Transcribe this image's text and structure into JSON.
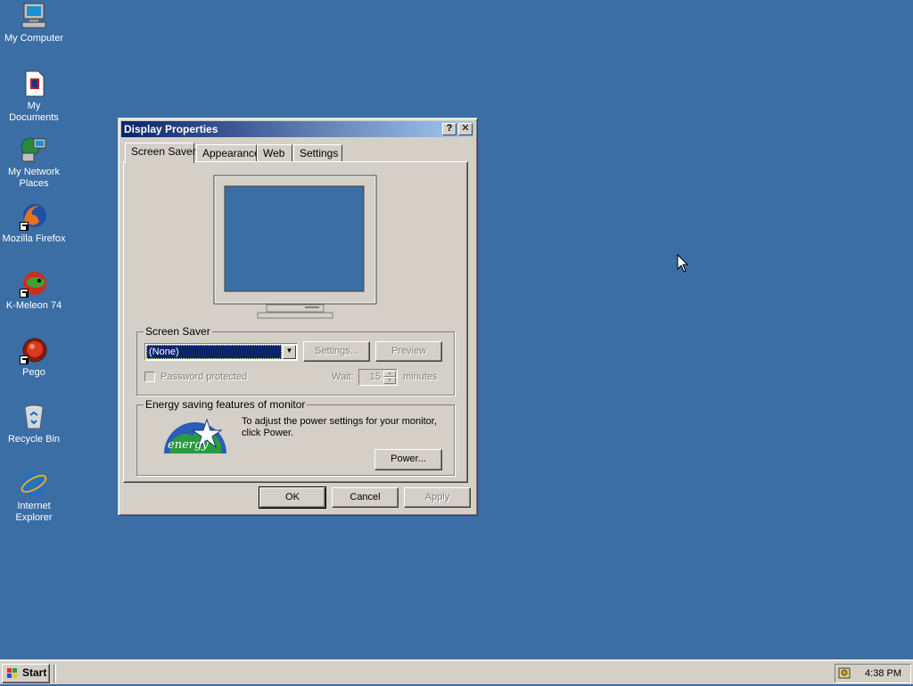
{
  "desktop": {
    "icons": [
      {
        "label": "My Computer",
        "icon": "computer-icon"
      },
      {
        "label": "My Documents",
        "icon": "documents-icon"
      },
      {
        "label": "My Network Places",
        "icon": "network-icon"
      },
      {
        "label": "Mozilla Firefox",
        "icon": "firefox-icon"
      },
      {
        "label": "K-Meleon 74",
        "icon": "kmeleon-icon"
      },
      {
        "label": "Pego",
        "icon": "pego-icon"
      },
      {
        "label": "Recycle Bin",
        "icon": "recycle-bin-icon"
      },
      {
        "label": "Internet Explorer",
        "icon": "ie-icon"
      }
    ]
  },
  "dialog": {
    "title": "Display Properties",
    "help_glyph": "?",
    "close_glyph": "✕",
    "tabs": [
      "Screen Saver",
      "Appearance",
      "Web",
      "Settings"
    ],
    "active_tab": "Screen Saver",
    "screen_saver": {
      "group_label": "Screen Saver",
      "selected": "(None)",
      "settings_label": "Settings...",
      "preview_label": "Preview",
      "password_label": "Password protected",
      "wait_label": "Wait:",
      "wait_value": "15",
      "minutes_label": "minutes"
    },
    "energy": {
      "group_label": "Energy saving features of monitor",
      "description": "To adjust the power settings for your monitor, click Power.",
      "logo_text": "energy",
      "power_label": "Power..."
    },
    "ok_label": "OK",
    "cancel_label": "Cancel",
    "apply_label": "Apply"
  },
  "taskbar": {
    "start_label": "Start",
    "clock": "4:38 PM"
  },
  "colors": {
    "desktop": "#3a6ea5",
    "title_active": "#0a246a",
    "face": "#d4d0c8"
  }
}
